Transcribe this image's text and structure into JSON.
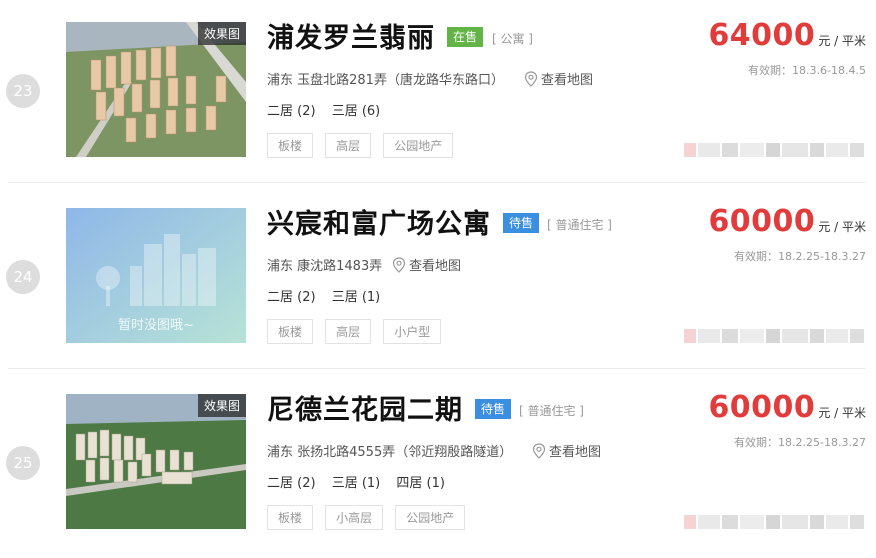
{
  "listings": [
    {
      "rank": "23",
      "name": "浦发罗兰翡丽",
      "status": "在售",
      "property_type": "[ 公寓 ]",
      "address": "浦东 玉盘北路281弄（唐龙路华东路口）",
      "map_link": "查看地图",
      "image_tag": "效果图",
      "rooms": [
        "二居 (2)",
        "三居 (6)"
      ],
      "tags": [
        "板楼",
        "高层",
        "公园地产"
      ],
      "price": "64000",
      "price_unit": "元 / 平米",
      "validity": "有效期：18.3.6-18.4.5"
    },
    {
      "rank": "24",
      "name": "兴宸和富广场公寓",
      "status": "待售",
      "property_type": "[ 普通住宅 ]",
      "address": "浦东 康沈路1483弄",
      "map_link": "查看地图",
      "image_placeholder": "暂时没图哦~",
      "rooms": [
        "二居 (2)",
        "三居 (1)"
      ],
      "tags": [
        "板楼",
        "高层",
        "小户型"
      ],
      "price": "60000",
      "price_unit": "元 / 平米",
      "validity": "有效期：18.2.25-18.3.27"
    },
    {
      "rank": "25",
      "name": "尼德兰花园二期",
      "status": "待售",
      "property_type": "[ 普通住宅 ]",
      "address": "浦东 张扬北路4555弄（邻近翔殷路隧道）",
      "map_link": "查看地图",
      "image_tag": "效果图",
      "rooms": [
        "二居 (2)",
        "三居 (1)",
        "四居 (1)"
      ],
      "tags": [
        "板楼",
        "小高层",
        "公园地产"
      ],
      "price": "60000",
      "price_unit": "元 / 平米",
      "validity": "有效期：18.2.25-18.3.27"
    }
  ],
  "colors": {
    "price": "#e23b3b",
    "status_onsale": "#62b446",
    "status_upcoming": "#3b8fe0"
  }
}
